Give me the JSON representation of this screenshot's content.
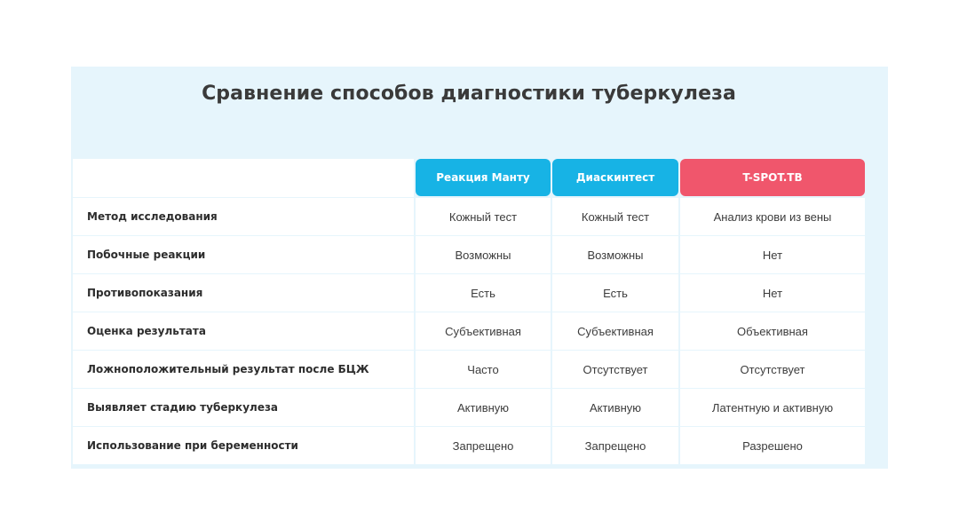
{
  "title": "Сравнение способов диагностики туберкулеза",
  "colors": {
    "background": "#e6f5fc",
    "manty_header": "#17b3e5",
    "diaskintest_header": "#17b3e5",
    "tspot_header": "#f0566c"
  },
  "headers": [
    {
      "label": "Реакция Манту"
    },
    {
      "label": "Диаскинтест"
    },
    {
      "label": "T-SPOT.TB"
    }
  ],
  "rows": [
    {
      "label": "Метод исследования",
      "values": [
        "Кожный тест",
        "Кожный тест",
        "Анализ крови из вены"
      ]
    },
    {
      "label": "Побочные реакции",
      "values": [
        "Возможны",
        "Возможны",
        "Нет"
      ]
    },
    {
      "label": "Противопоказания",
      "values": [
        "Есть",
        "Есть",
        "Нет"
      ]
    },
    {
      "label": "Оценка результата",
      "values": [
        "Субъективная",
        "Субъективная",
        "Объективная"
      ]
    },
    {
      "label": "Ложноположительный результат после БЦЖ",
      "values": [
        "Часто",
        "Отсутствует",
        "Отсутствует"
      ]
    },
    {
      "label": "Выявляет стадию туберкулеза",
      "values": [
        "Активную",
        "Активную",
        "Латентную и активную"
      ]
    },
    {
      "label": "Использование при беременности",
      "values": [
        "Запрещено",
        "Запрещено",
        "Разрешено"
      ]
    }
  ]
}
